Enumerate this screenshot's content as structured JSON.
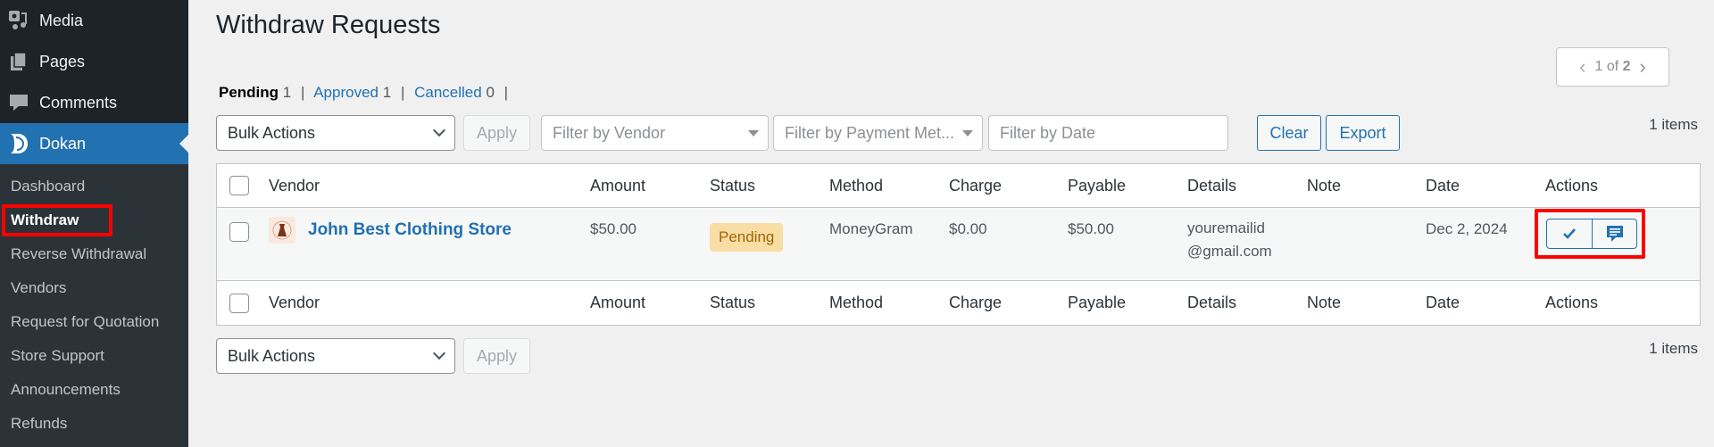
{
  "sidebar": {
    "top_items": [
      {
        "label": "Media",
        "icon": "media-icon"
      },
      {
        "label": "Pages",
        "icon": "pages-icon"
      },
      {
        "label": "Comments",
        "icon": "comments-icon"
      }
    ],
    "current": {
      "label": "Dokan",
      "icon": "dokan-logo-icon"
    },
    "submenu": [
      {
        "label": "Dashboard",
        "active": false
      },
      {
        "label": "Withdraw",
        "active": true
      },
      {
        "label": "Reverse Withdrawal",
        "active": false
      },
      {
        "label": "Vendors",
        "active": false
      },
      {
        "label": "Request for Quotation",
        "active": false
      },
      {
        "label": "Store Support",
        "active": false
      },
      {
        "label": "Announcements",
        "active": false
      },
      {
        "label": "Refunds",
        "active": false
      }
    ]
  },
  "page": {
    "title": "Withdraw Requests"
  },
  "status_links": [
    {
      "label": "Pending",
      "count": "1",
      "current": true
    },
    {
      "label": "Approved",
      "count": "1",
      "current": false
    },
    {
      "label": "Cancelled",
      "count": "0",
      "current": false
    }
  ],
  "pagination": {
    "current": "1",
    "of_label": "of",
    "total": "2"
  },
  "toolbar": {
    "bulk_actions": "Bulk Actions",
    "apply": "Apply",
    "filter_vendor": "Filter by Vendor",
    "filter_payment": "Filter by Payment Met...",
    "filter_date_placeholder": "Filter by Date",
    "clear": "Clear",
    "export": "Export",
    "items_count": "1 items"
  },
  "table": {
    "columns": [
      "Vendor",
      "Amount",
      "Status",
      "Method",
      "Charge",
      "Payable",
      "Details",
      "Note",
      "Date",
      "Actions"
    ],
    "rows": [
      {
        "vendor": "John Best Clothing Store",
        "amount": "$50.00",
        "status": "Pending",
        "method": "MoneyGram",
        "charge": "$0.00",
        "payable": "$50.00",
        "details_line1": "youremailid",
        "details_line2": "@gmail.com",
        "note": "",
        "date": "Dec 2, 2024",
        "actions": [
          "approve-check-icon",
          "add-note-comment-icon"
        ]
      }
    ]
  },
  "bottom_toolbar": {
    "bulk_actions": "Bulk Actions",
    "apply": "Apply",
    "items_count": "1 items"
  },
  "colors": {
    "accent": "#2271b1",
    "sidebar_bg": "#2c3338",
    "pending_badge_bg": "#f8dda4",
    "pending_badge_text": "#a16508",
    "highlight": "#ff0000"
  }
}
